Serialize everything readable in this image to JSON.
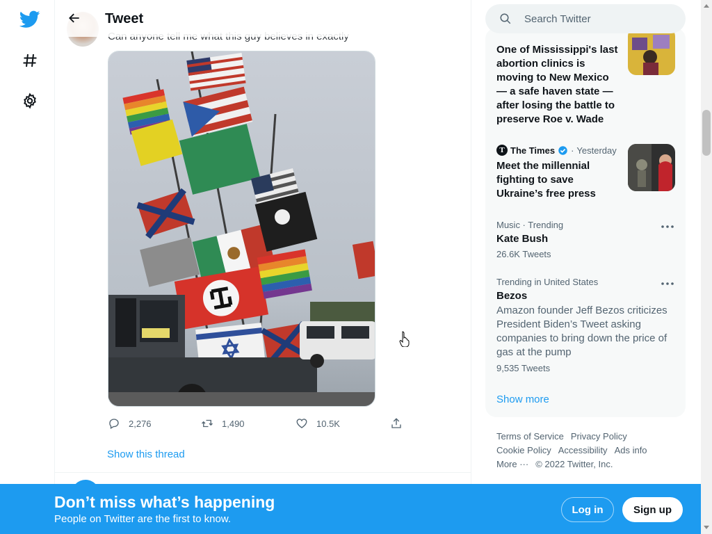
{
  "header": {
    "title": "Tweet"
  },
  "nav": {
    "icons": [
      "twitter-logo-icon",
      "explore-hash-icon",
      "settings-gear-icon"
    ]
  },
  "tweet": {
    "text": "Can anyone tell me what this guy believes in exactly",
    "media_description": "pickup truck flying many flags",
    "actions": {
      "replies": "2,276",
      "retweets": "1,490",
      "likes": "10.5K"
    },
    "show_thread": "Show this thread"
  },
  "search": {
    "placeholder": "Search Twitter"
  },
  "trends": {
    "news": [
      {
        "headline": "One of Mississippi's last abortion clinics is moving to New Mexico — a safe haven state — after losing the battle to preserve Roe v. Wade"
      },
      {
        "source": "The Times",
        "time": "Yesterday",
        "headline": "Meet the millennial fighting to save Ukraine’s free press"
      }
    ],
    "topics": [
      {
        "meta": "Music · Trending",
        "name": "Kate Bush",
        "count": "26.6K Tweets"
      },
      {
        "meta": "Trending in United States",
        "name": "Bezos",
        "description": "Amazon founder Jeff Bezos criticizes President Biden’s Tweet asking companies to bring down the price of gas at the pump",
        "count": "9,535 Tweets"
      }
    ],
    "show_more": "Show more"
  },
  "footer": {
    "links_row1": [
      "Terms of Service",
      "Privacy Policy"
    ],
    "links_row2": [
      "Cookie Policy",
      "Accessibility",
      "Ads info"
    ],
    "more": "More ···",
    "copyright": "© 2022 Twitter, Inc."
  },
  "bottom_bar": {
    "title": "Don’t miss what’s happening",
    "subtitle": "People on Twitter are the first to know.",
    "login": "Log in",
    "signup": "Sign up"
  },
  "colors": {
    "accent": "#1d9bf0",
    "text": "#0f1419",
    "muted": "#536471"
  }
}
